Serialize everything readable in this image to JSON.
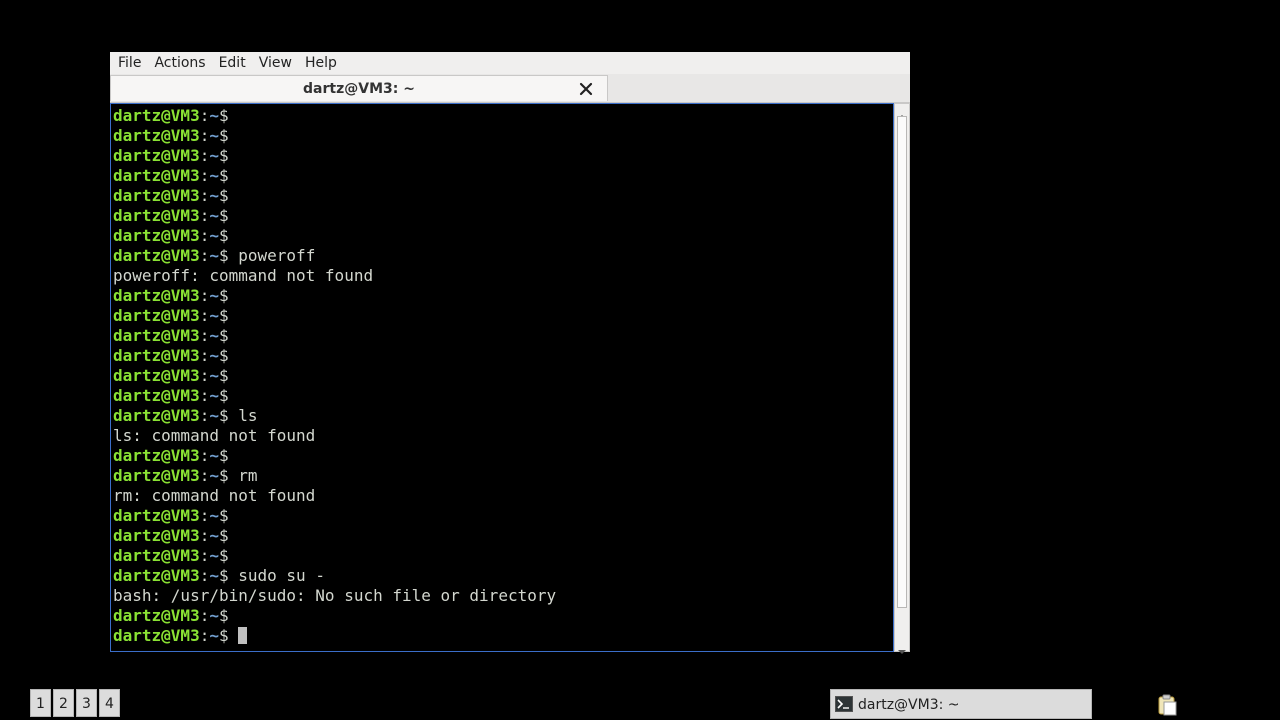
{
  "menubar": {
    "items": [
      "File",
      "Actions",
      "Edit",
      "View",
      "Help"
    ]
  },
  "tab": {
    "title": "dartz@VM3: ~"
  },
  "terminal": {
    "prompt_user": "dartz@VM3",
    "prompt_sep": ":",
    "prompt_dir": "~",
    "prompt_sign": "$",
    "lines": [
      {
        "type": "prompt",
        "cmd": ""
      },
      {
        "type": "prompt",
        "cmd": ""
      },
      {
        "type": "prompt",
        "cmd": ""
      },
      {
        "type": "prompt",
        "cmd": ""
      },
      {
        "type": "prompt",
        "cmd": ""
      },
      {
        "type": "prompt",
        "cmd": ""
      },
      {
        "type": "prompt",
        "cmd": ""
      },
      {
        "type": "prompt",
        "cmd": " poweroff"
      },
      {
        "type": "output",
        "text": "poweroff: command not found"
      },
      {
        "type": "prompt",
        "cmd": ""
      },
      {
        "type": "prompt",
        "cmd": ""
      },
      {
        "type": "prompt",
        "cmd": ""
      },
      {
        "type": "prompt",
        "cmd": ""
      },
      {
        "type": "prompt",
        "cmd": ""
      },
      {
        "type": "prompt",
        "cmd": ""
      },
      {
        "type": "prompt",
        "cmd": " ls"
      },
      {
        "type": "output",
        "text": "ls: command not found"
      },
      {
        "type": "prompt",
        "cmd": ""
      },
      {
        "type": "prompt",
        "cmd": " rm"
      },
      {
        "type": "output",
        "text": "rm: command not found"
      },
      {
        "type": "prompt",
        "cmd": ""
      },
      {
        "type": "prompt",
        "cmd": ""
      },
      {
        "type": "prompt",
        "cmd": ""
      },
      {
        "type": "prompt",
        "cmd": " sudo su -"
      },
      {
        "type": "output",
        "text": "bash: /usr/bin/sudo: No such file or directory"
      },
      {
        "type": "prompt",
        "cmd": ""
      },
      {
        "type": "prompt",
        "cmd": " ",
        "cursor": true
      }
    ]
  },
  "taskbar": {
    "workspaces": [
      "1",
      "2",
      "3",
      "4"
    ],
    "task_label": "dartz@VM3: ~"
  },
  "colors": {
    "prompt": "#8ae234",
    "dir": "#729fcf",
    "text": "#d3d7cf",
    "border": "#3b6ec9"
  },
  "icons": {
    "tab_close": "close-icon",
    "task": "terminal-icon",
    "tray": "clipboard-icon"
  }
}
